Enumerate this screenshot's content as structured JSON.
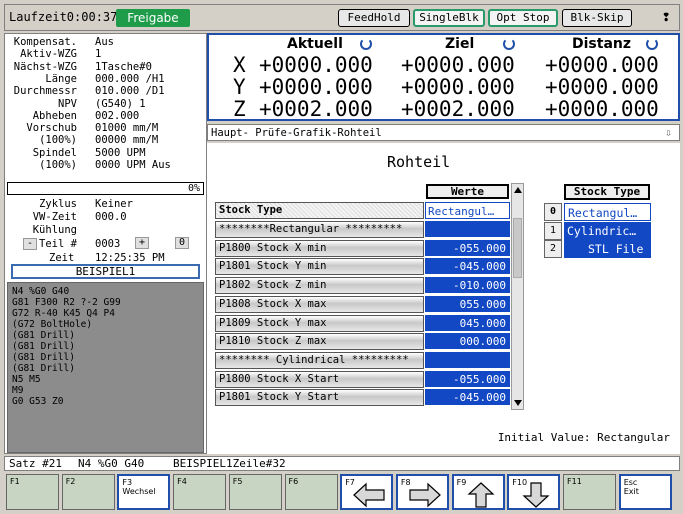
{
  "topbar": {
    "runtime": "Laufzeit0:00:37",
    "release": "Freigabe",
    "buttons": [
      "FeedHold",
      "SingleBlk",
      "Opt Stop",
      "Blk-Skip"
    ],
    "end_glyph": "❢"
  },
  "left": {
    "rows": [
      {
        "k": "Kompensat.",
        "v": "Aus"
      },
      {
        "k": "Aktiv-WZG",
        "v": "1"
      },
      {
        "k": "Nächst-WZG",
        "v": "1Tasche#0"
      },
      {
        "k": "Länge",
        "v": "000.000 /H1"
      },
      {
        "k": "Durchmessr",
        "v": "010.000 /D1"
      },
      {
        "k": "NPV",
        "v": "(G540) 1"
      },
      {
        "k": "Abheben",
        "v": "002.000"
      },
      {
        "k": "Vorschub",
        "v": "01000 mm/M"
      },
      {
        "k": "(100%)",
        "v": "00000 mm/M"
      },
      {
        "k": "Spindel",
        "v": "5000 UPM"
      },
      {
        "k": "(100%)",
        "v": "0000 UPM Aus"
      }
    ],
    "progress": "0%",
    "progress_fraction": 0,
    "rows2": [
      {
        "k": "Zyklus",
        "v": "Keiner"
      },
      {
        "k": "VW-Zeit",
        "v": "000.0"
      },
      {
        "k": "Kühlung",
        "v": ""
      }
    ],
    "part_minus": "-",
    "part_label": "Teil #",
    "part_value": "0003",
    "part_plus": "+",
    "part_extra": "0",
    "time_label": "Zeit",
    "time_value": "12:25:35 PM",
    "program": "BEISPIEL1",
    "code": [
      "N4 %G0 G40",
      "G81 F300 R2 ?-2 G99",
      "G72 R-40 K45 Q4 P4",
      "(G72 BoltHole)",
      "(G81 Drill)",
      "(G81 Drill)",
      "(G81 Drill)",
      "(G81 Drill)",
      "N5 M5",
      "M9",
      "G0 G53 Z0"
    ]
  },
  "position": {
    "headers": [
      "Aktuell",
      "Ziel",
      "Distanz"
    ],
    "rows": [
      {
        "axis": "X",
        "aktuell": "+0000.000",
        "ziel": "+0000.000",
        "distanz": "+0000.000"
      },
      {
        "axis": "Y",
        "aktuell": "+0000.000",
        "ziel": "+0000.000",
        "distanz": "+0000.000"
      },
      {
        "axis": "Z",
        "aktuell": "+0002.000",
        "ziel": "+0002.000",
        "distanz": "+0000.000"
      }
    ]
  },
  "tabs": {
    "text": "Haupt-   Prüfe-Grafik-Rohteil"
  },
  "main": {
    "title": "Rohteil",
    "values_header": "Werte",
    "type_label": "Stock Type",
    "type_value": "Rectangul…",
    "rows": [
      {
        "name": "********Rectangular *********",
        "value": ""
      },
      {
        "name": "P1800 Stock X min",
        "value": "-055.000"
      },
      {
        "name": "P1801 Stock Y min",
        "value": "-045.000"
      },
      {
        "name": "P1802 Stock Z min",
        "value": "-010.000"
      },
      {
        "name": "P1808 Stock X max",
        "value": "055.000"
      },
      {
        "name": "P1809 Stock Y max",
        "value": "045.000"
      },
      {
        "name": "P1810 Stock Z max",
        "value": "000.000"
      },
      {
        "name": "******** Cylindrical *********",
        "value": ""
      },
      {
        "name": "P1800 Stock X Start",
        "value": "-055.000"
      },
      {
        "name": "P1801 Stock Y Start",
        "value": "-045.000"
      }
    ],
    "stock_header": "Stock Type",
    "stock_options": [
      {
        "idx": "0",
        "label": "Rectangul…"
      },
      {
        "idx": "1",
        "label": "Cylindric…"
      },
      {
        "idx": "2",
        "label": "STL File"
      }
    ],
    "initial_value": "Initial Value: Rectangular"
  },
  "status": {
    "satz": "Satz #21",
    "block": "N4 %G0 G40",
    "file": "BEISPIEL1Zeile#32"
  },
  "fkeys": [
    {
      "label": "F1",
      "sub": ""
    },
    {
      "label": "F2",
      "sub": ""
    },
    {
      "label": "F3",
      "sub": "Wechsel"
    },
    {
      "label": "F4",
      "sub": ""
    },
    {
      "label": "F5",
      "sub": ""
    },
    {
      "label": "F6",
      "sub": ""
    },
    {
      "label": "F7",
      "sub": ""
    },
    {
      "label": "F8",
      "sub": ""
    },
    {
      "label": "F9",
      "sub": ""
    },
    {
      "label": "F10",
      "sub": ""
    },
    {
      "label": "F11",
      "sub": ""
    },
    {
      "label": "Esc",
      "sub": "Exit"
    }
  ],
  "colors": {
    "accent": "#1f4fa8",
    "selection": "#1248c4",
    "release": "#1e9c4a",
    "fkey": "#c9d5c3"
  }
}
